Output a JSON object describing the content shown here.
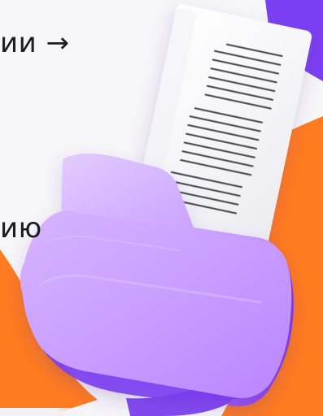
{
  "hero": {
    "text": "ии →\n\nию"
  },
  "visual": {
    "document_icon": "document-icon",
    "folder_icon": "folder-icon"
  },
  "colors": {
    "purple": "#7b3ff2",
    "folder_light": "#cfa6ff",
    "folder_mid": "#a872f5",
    "folder_dark": "#8e54f2",
    "orange": "#ff7b1f",
    "paper": "#f7f7f7",
    "text": "#1d1d1f"
  }
}
